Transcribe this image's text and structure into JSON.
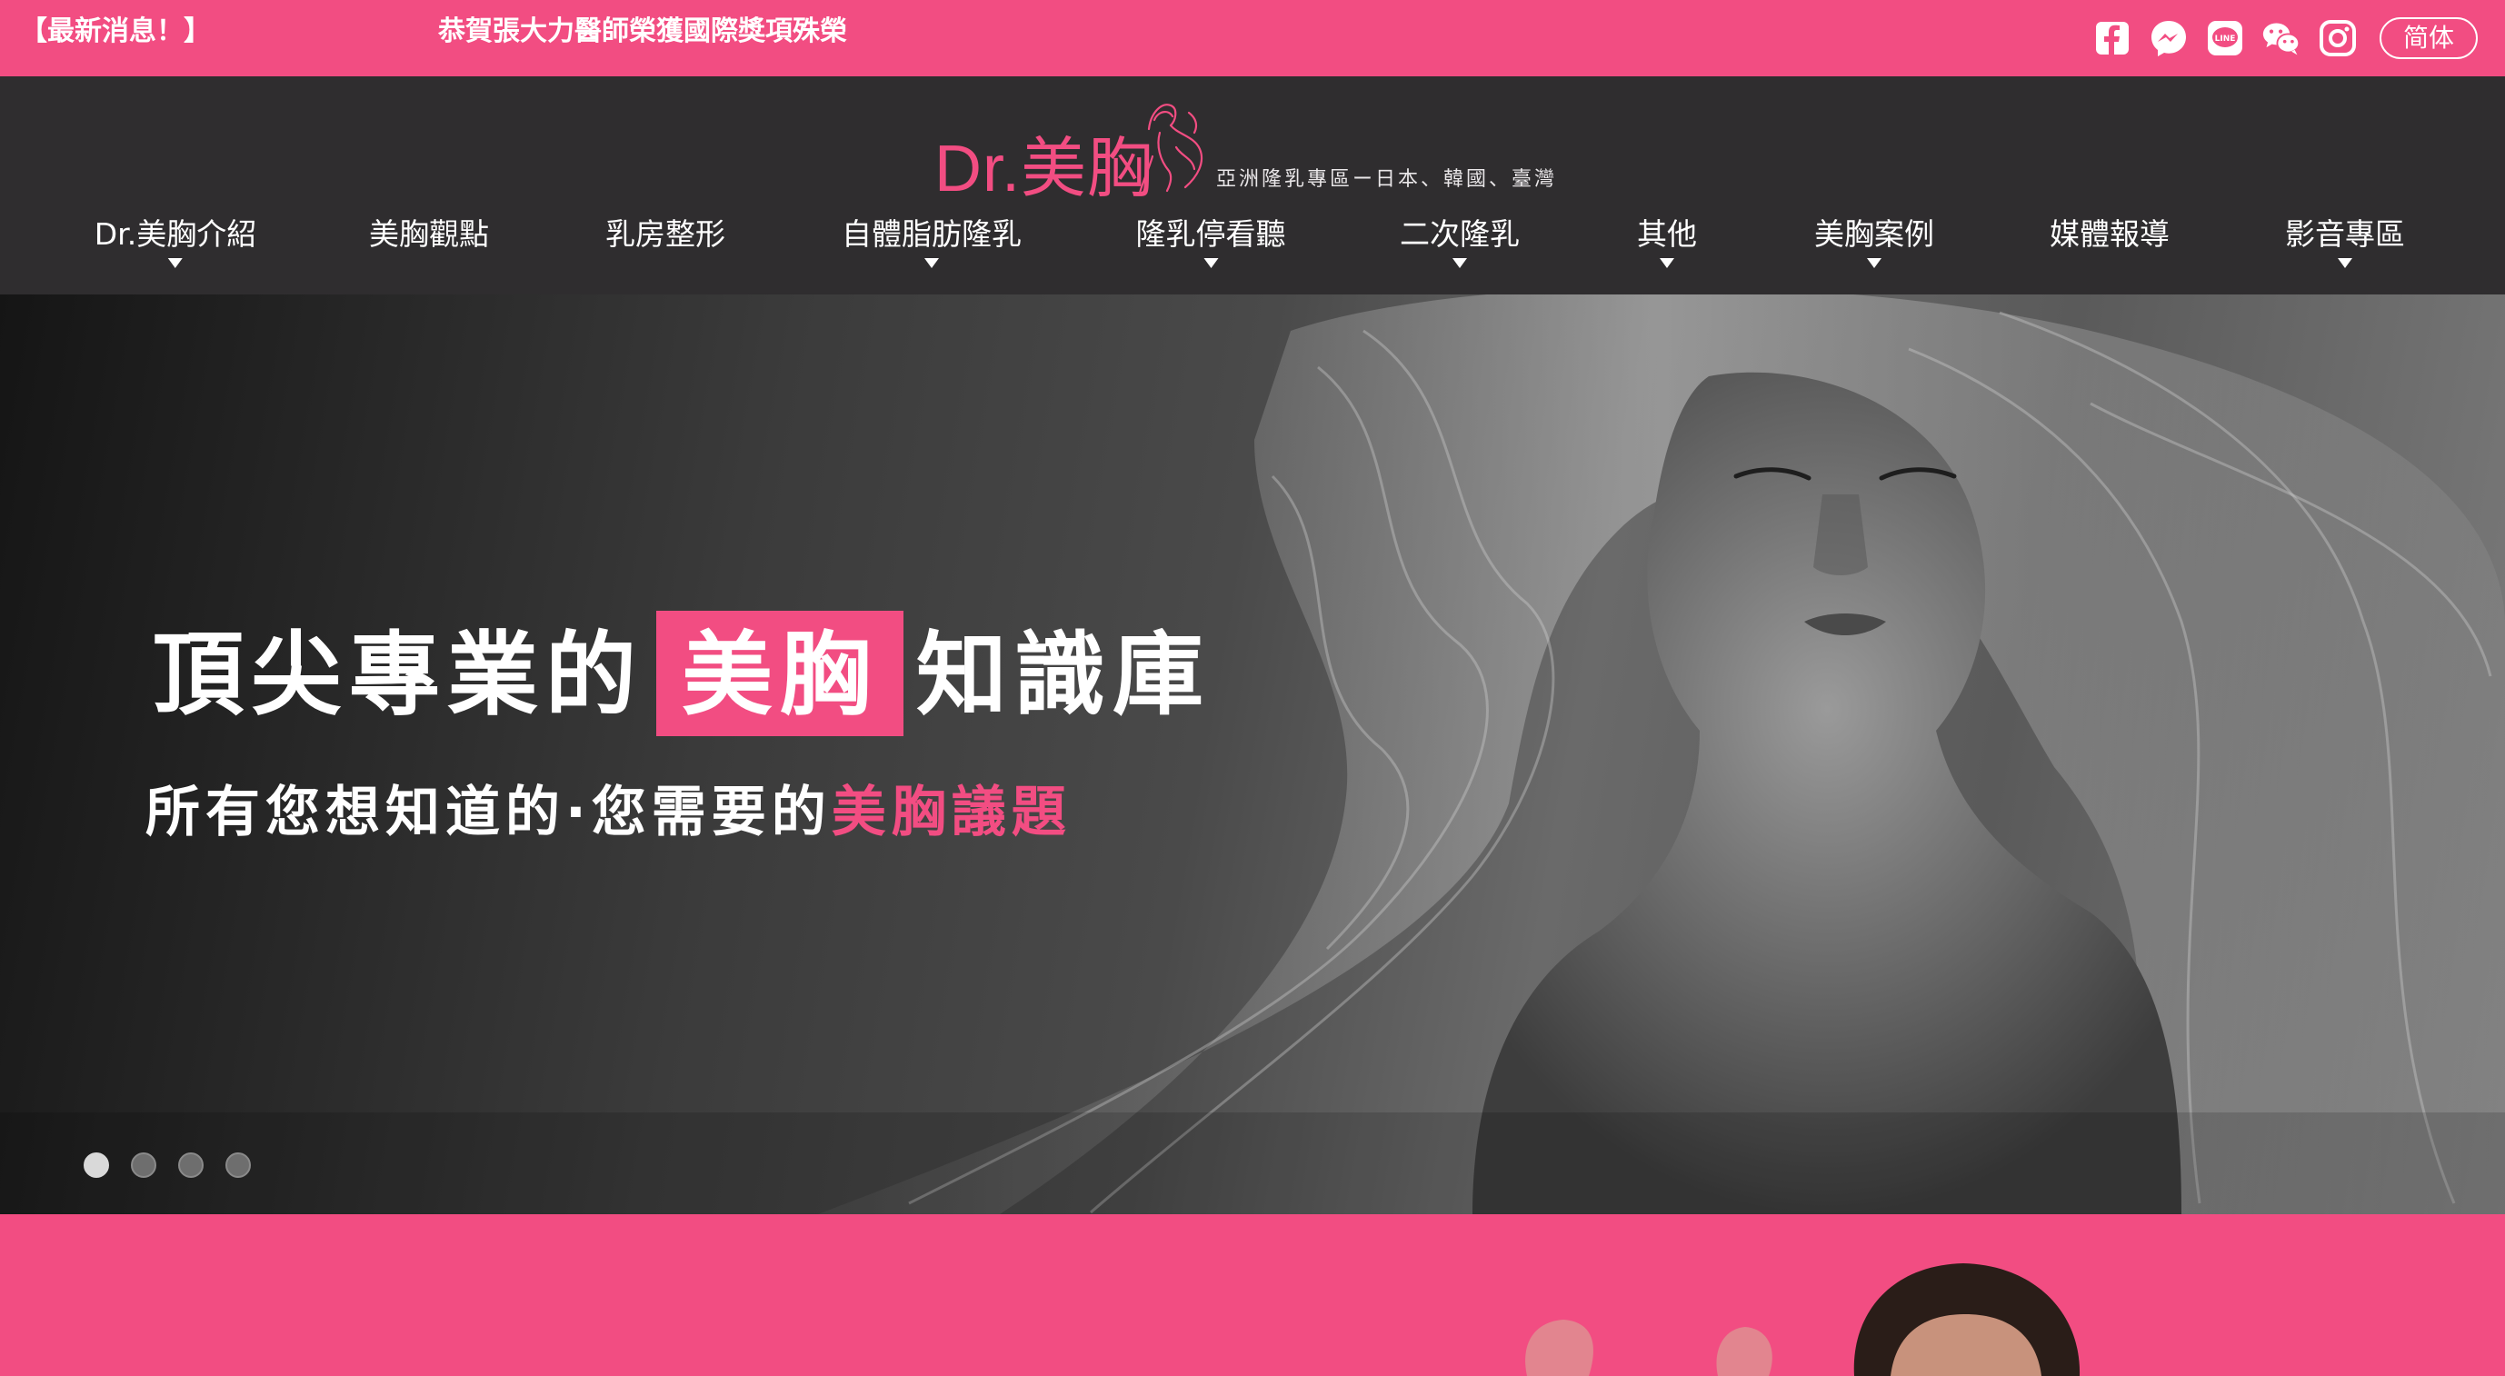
{
  "topbar": {
    "news_label": "【最新消息！】",
    "news_text": "恭賀張大力醫師榮獲國際獎項殊榮",
    "social_icons": [
      "facebook-icon",
      "messenger-icon",
      "line-icon",
      "wechat-icon",
      "instagram-icon"
    ],
    "lang_button": "简体"
  },
  "logo": {
    "main": "Dr.美胸",
    "sub": "亞洲隆乳專區ー日本、韓國、臺灣"
  },
  "nav": {
    "items": [
      {
        "label": "Dr.美胸介紹",
        "dropdown": true
      },
      {
        "label": "美胸觀點",
        "dropdown": false
      },
      {
        "label": "乳房整形",
        "dropdown": false
      },
      {
        "label": "自體脂肪隆乳",
        "dropdown": true
      },
      {
        "label": "隆乳停看聽",
        "dropdown": true
      },
      {
        "label": "二次隆乳",
        "dropdown": true
      },
      {
        "label": "其他",
        "dropdown": true
      },
      {
        "label": "美胸案例",
        "dropdown": true
      },
      {
        "label": "媒體報導",
        "dropdown": false
      },
      {
        "label": "影音專區",
        "dropdown": true
      }
    ]
  },
  "hero": {
    "title_pre": "頂尖專業的",
    "title_highlight": "美胸",
    "title_post": "知識庫",
    "sub_pre": "所有您想知道的·您需要的",
    "sub_highlight": "美胸議題",
    "slides_total": 4,
    "active_slide": 1
  },
  "colors": {
    "brand_pink": "#f24d82",
    "header_dark": "#2f2d2f"
  }
}
